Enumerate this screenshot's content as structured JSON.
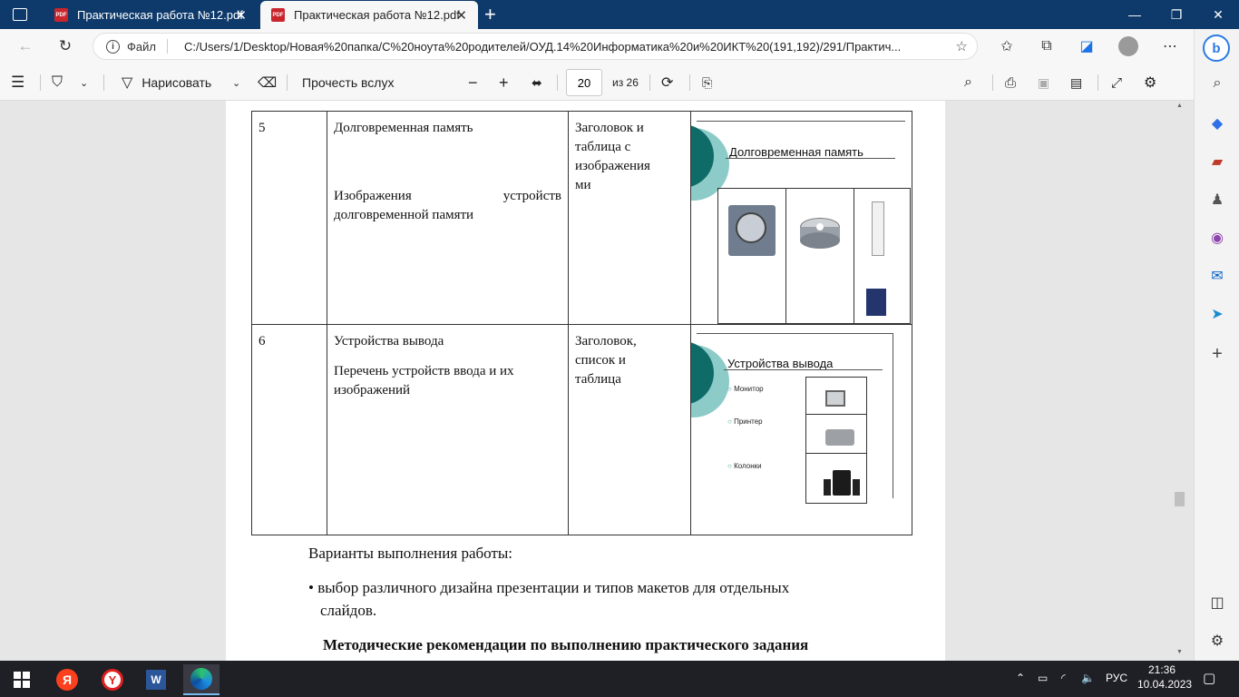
{
  "tabs": [
    {
      "label": "Практическая работа №12.pdf",
      "active": false
    },
    {
      "label": "Практическая работа №12.pdf",
      "active": true
    }
  ],
  "address": {
    "file_label": "Файл",
    "url": "C:/Users/1/Desktop/Новая%20папка/С%20ноута%20родителей/ОУД.14%20Информатика%20и%20ИКТ%20(191,192)/291/Практич..."
  },
  "pdf_toolbar": {
    "draw_label": "Нарисовать",
    "read_aloud_label": "Прочесть вслух",
    "page_current": "20",
    "page_total": "из 26"
  },
  "document": {
    "rows": [
      {
        "num": "5",
        "title": "Долговременная память",
        "desc_words": [
          "Изображения",
          "устройств"
        ],
        "desc_last": "долговременной памяти",
        "layout": [
          "Заголовок и",
          "таблица с",
          "изображения",
          "ми"
        ],
        "slide_title": "Долговременная память"
      },
      {
        "num": "6",
        "title": "Устройства вывода",
        "desc": [
          "Перечень устройств ввода и их",
          "изображений"
        ],
        "layout": [
          "Заголовок,",
          "список и",
          "таблица"
        ],
        "slide_title": "Устройства вывода",
        "bullets": [
          "Монитор",
          "Принтер",
          "Колонки"
        ]
      }
    ],
    "variants_heading": "Варианты выполнения работы:",
    "variant_item_line1": "• выбор различного дизайна презентации и типов макетов для отдельных",
    "variant_item_line2": "слайдов.",
    "method_heading": "Методические рекомендации по выполнению практического задания"
  },
  "taskbar": {
    "lang": "РУС",
    "time": "21:36",
    "date": "10.04.2023"
  },
  "colors": {
    "titlebar": "#0e3a6b",
    "accent_teal": "#0f6b68"
  }
}
